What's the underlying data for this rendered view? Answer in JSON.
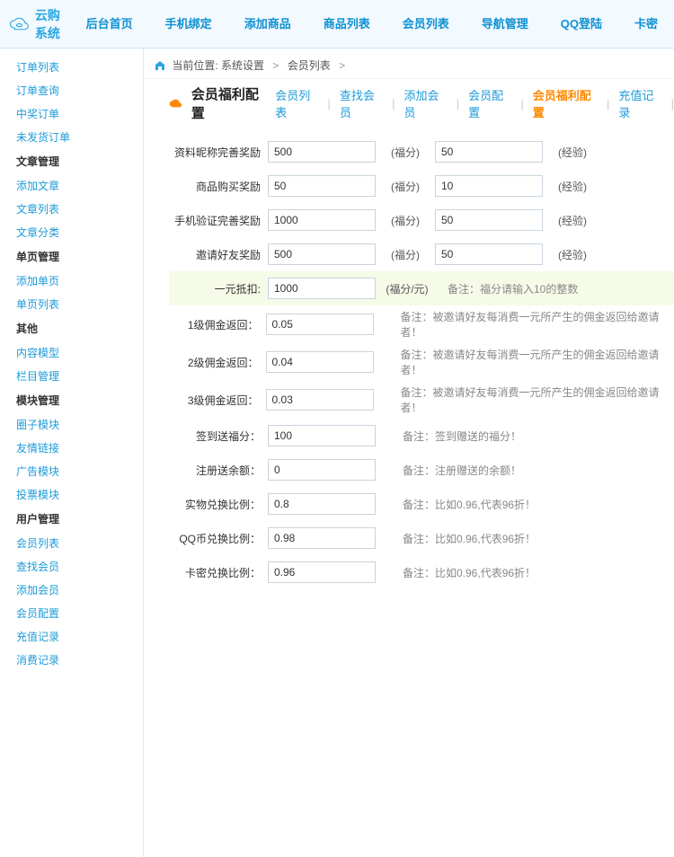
{
  "topnav": [
    "后台首页",
    "手机绑定",
    "添加商品",
    "商品列表",
    "会员列表",
    "导航管理",
    "QQ登陆",
    "卡密"
  ],
  "logo_text": "云购系统",
  "sidebar": [
    {
      "t": "i",
      "l": "订单列表"
    },
    {
      "t": "i",
      "l": "订单查询"
    },
    {
      "t": "i",
      "l": "中奖订单"
    },
    {
      "t": "i",
      "l": "未发货订单"
    },
    {
      "t": "c",
      "l": "文章管理"
    },
    {
      "t": "i",
      "l": "添加文章"
    },
    {
      "t": "i",
      "l": "文章列表"
    },
    {
      "t": "i",
      "l": "文章分类"
    },
    {
      "t": "c",
      "l": "单页管理"
    },
    {
      "t": "i",
      "l": "添加单页"
    },
    {
      "t": "i",
      "l": "单页列表"
    },
    {
      "t": "c",
      "l": "其他"
    },
    {
      "t": "i",
      "l": "内容模型"
    },
    {
      "t": "i",
      "l": "栏目管理"
    },
    {
      "t": "c",
      "l": "模块管理"
    },
    {
      "t": "i",
      "l": "圈子模块"
    },
    {
      "t": "i",
      "l": "友情链接"
    },
    {
      "t": "i",
      "l": "广告模块"
    },
    {
      "t": "i",
      "l": "投票模块"
    },
    {
      "t": "c",
      "l": "用户管理"
    },
    {
      "t": "i",
      "l": "会员列表"
    },
    {
      "t": "i",
      "l": "查找会员"
    },
    {
      "t": "i",
      "l": "添加会员"
    },
    {
      "t": "i",
      "l": "会员配置"
    },
    {
      "t": "i",
      "l": "充值记录"
    },
    {
      "t": "i",
      "l": "消费记录"
    }
  ],
  "crumb": {
    "prefix": "当前位置:",
    "a": "系统设置",
    "b": "会员列表",
    "tail": ""
  },
  "tab": {
    "title": "会员福利配置",
    "links": [
      "会员列表",
      "查找会员",
      "添加会员",
      "会员配置",
      "会员福利配置",
      "充值记录"
    ],
    "active": 4
  },
  "rows_dual": [
    {
      "label": "资料昵称完善奖励",
      "v1": "500",
      "u1": "(福分)",
      "v2": "50",
      "u2": "(经验)"
    },
    {
      "label": "商品购买奖励",
      "v1": "50",
      "u1": "(福分)",
      "v2": "10",
      "u2": "(经验)"
    },
    {
      "label": "手机验证完善奖励",
      "v1": "1000",
      "u1": "(福分)",
      "v2": "50",
      "u2": "(经验)"
    },
    {
      "label": "邀请好友奖励",
      "v1": "500",
      "u1": "(福分)",
      "v2": "50",
      "u2": "(经验)"
    }
  ],
  "row_hl": {
    "label": "一元抵扣:",
    "v": "1000",
    "unit": "(福分/元)",
    "note": "备注：福分请输入10的整数"
  },
  "rows_single": [
    {
      "label": "1级佣金返回：",
      "v": "0.05",
      "note": "备注：被邀请好友每消费一元所产生的佣金返回给邀请者！"
    },
    {
      "label": "2级佣金返回：",
      "v": "0.04",
      "note": "备注：被邀请好友每消费一元所产生的佣金返回给邀请者！"
    },
    {
      "label": "3级佣金返回：",
      "v": "0.03",
      "note": "备注：被邀请好友每消费一元所产生的佣金返回给邀请者！"
    },
    {
      "label": "签到送福分：",
      "v": "100",
      "note": "备注：签到赠送的福分！"
    },
    {
      "label": "注册送余额：",
      "v": "0",
      "note": "备注：注册赠送的余额！"
    },
    {
      "label": "实物兑换比例：",
      "v": "0.8",
      "note": "备注：比如0.96,代表96折！"
    },
    {
      "label": "QQ币兑换比例：",
      "v": "0.98",
      "note": "备注：比如0.96,代表96折！"
    },
    {
      "label": "卡密兑换比例：",
      "v": "0.96",
      "note": "备注：比如0.96,代表96折！"
    }
  ]
}
